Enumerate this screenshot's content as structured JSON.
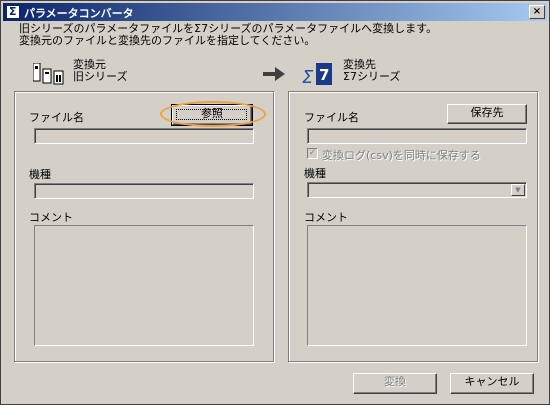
{
  "window": {
    "title": "パラメータコンバータ",
    "close_glyph": "×"
  },
  "description": {
    "line1": "旧シリーズのパラメータファイルをΣ7シリーズのパラメータファイルへ変換します。",
    "line2": "変換元のファイルと変換先のファイルを指定してください。"
  },
  "source": {
    "heading_line1": "変換元",
    "heading_line2": "旧シリーズ",
    "icon": "servo-units-icon",
    "file_label": "ファイル名",
    "browse_label": "参照",
    "file_value": "",
    "model_label": "機種",
    "model_value": "",
    "comment_label": "コメント",
    "comment_value": ""
  },
  "arrow_icon": "right-arrow-icon",
  "destination": {
    "heading_line1": "変換先",
    "heading_line2": "Σ7シリーズ",
    "icon": "sigma7-icon",
    "file_label": "ファイル名",
    "save_as_label": "保存先",
    "file_value": "",
    "log_checkbox_label": "変換ログ(csv)を同時に保存する",
    "log_checkbox_checked": true,
    "model_label": "機種",
    "model_value": "",
    "comment_label": "コメント",
    "comment_value": ""
  },
  "footer": {
    "convert_label": "変換",
    "cancel_label": "キャンセル"
  },
  "colors": {
    "titlebar_start": "#0a246a",
    "highlight_ring": "#f0a040"
  }
}
